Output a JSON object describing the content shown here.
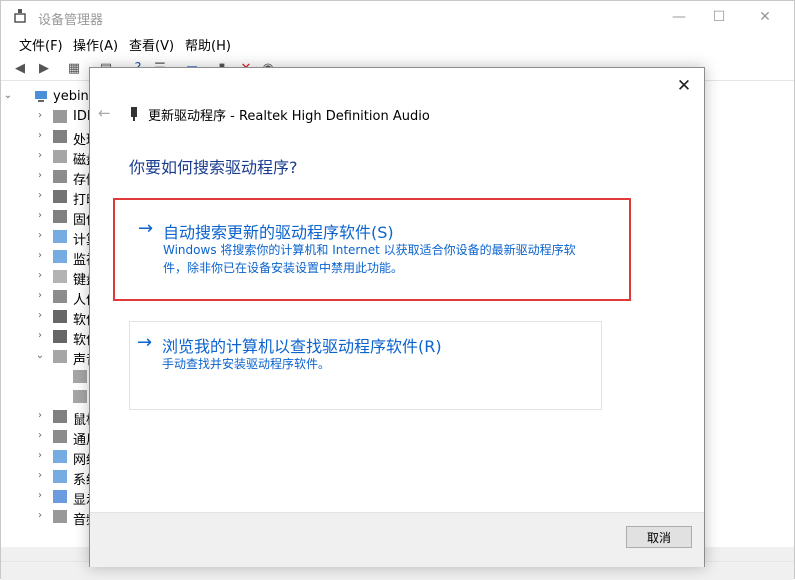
{
  "window": {
    "title": "设备管理器",
    "controls": {
      "minimize": "—",
      "maximize": "☐",
      "close": "✕"
    }
  },
  "menu": [
    "文件(F)",
    "操作(A)",
    "查看(V)",
    "帮助(H)"
  ],
  "toolbar": {
    "icons": [
      "back-icon",
      "forward-icon",
      "properties-icon",
      "show-hidden-icon",
      "help-icon",
      "list-icon",
      "monitor-icon",
      "update-driver-icon",
      "uninstall-icon",
      "disable-icon"
    ]
  },
  "tree": {
    "root": "yebin",
    "items": [
      {
        "label": "IDE"
      },
      {
        "label": "处理"
      },
      {
        "label": "磁盘"
      },
      {
        "label": "存储"
      },
      {
        "label": "打印"
      },
      {
        "label": "固件"
      },
      {
        "label": "计算"
      },
      {
        "label": "监视"
      },
      {
        "label": "键盘"
      },
      {
        "label": "人体"
      },
      {
        "label": "软件"
      },
      {
        "label": "软件"
      },
      {
        "label": "声音"
      },
      {
        "label": ""
      },
      {
        "label": ""
      },
      {
        "label": "鼠标"
      },
      {
        "label": "通用"
      },
      {
        "label": "网络"
      },
      {
        "label": "系统"
      },
      {
        "label": "显示"
      },
      {
        "label": "音频"
      }
    ]
  },
  "dialog": {
    "title": "更新驱动程序 - Realtek High Definition Audio",
    "question": "你要如何搜索驱动程序?",
    "option_auto": {
      "title": "自动搜索更新的驱动程序软件(S)",
      "desc": "Windows 将搜索你的计算机和 Internet 以获取适合你设备的最新驱动程序软件，除非你已在设备安装设置中禁用此功能。"
    },
    "option_browse": {
      "title": "浏览我的计算机以查找驱动程序软件(R)",
      "desc": "手动查找并安装驱动程序软件。"
    },
    "cancel_label": "取消"
  },
  "colors": {
    "link_blue": "#0b63ce",
    "highlight_red": "#e0393a",
    "heading_blue": "#1a3c8f"
  }
}
